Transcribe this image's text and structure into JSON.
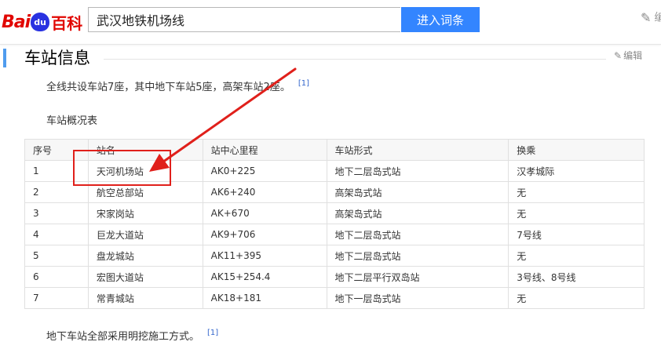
{
  "header": {
    "logo_bai": "Bai",
    "logo_du": "du",
    "logo_baike": "百科",
    "search_value": "武汉地铁机场线",
    "search_button": "进入词条",
    "edit_label": "编"
  },
  "section": {
    "title": "车站信息",
    "edit_label": "编辑"
  },
  "intro": {
    "text": "全线共设车站7座，其中地下车站5座，高架车站2座。",
    "ref": "[1]"
  },
  "table_caption": "车站概况表",
  "table": {
    "headers": [
      "序号",
      "站名",
      "站中心里程",
      "车站形式",
      "换乘"
    ],
    "rows": [
      [
        "1",
        "天河机场站",
        "AK0+225",
        "地下二层岛式站",
        "汉孝城际"
      ],
      [
        "2",
        "航空总部站",
        "AK6+240",
        "高架岛式站",
        "无"
      ],
      [
        "3",
        "宋家岗站",
        "AK+670",
        "高架岛式站",
        "无"
      ],
      [
        "4",
        "巨龙大道站",
        "AK9+706",
        "地下二层岛式站",
        "7号线"
      ],
      [
        "5",
        "盘龙城站",
        "AK11+395",
        "地下二层岛式站",
        "无"
      ],
      [
        "6",
        "宏图大道站",
        "AK15+254.4",
        "地下二层平行双岛站",
        "3号线、8号线"
      ],
      [
        "7",
        "常青城站",
        "AK18+181",
        "地下一层岛式站",
        "无"
      ]
    ]
  },
  "footer": {
    "text": "地下车站全部采用明挖施工方式。",
    "ref": "[1]"
  },
  "colors": {
    "accent": "#3385ff",
    "brand_red": "#e10601",
    "annotation_red": "#e0201b"
  }
}
